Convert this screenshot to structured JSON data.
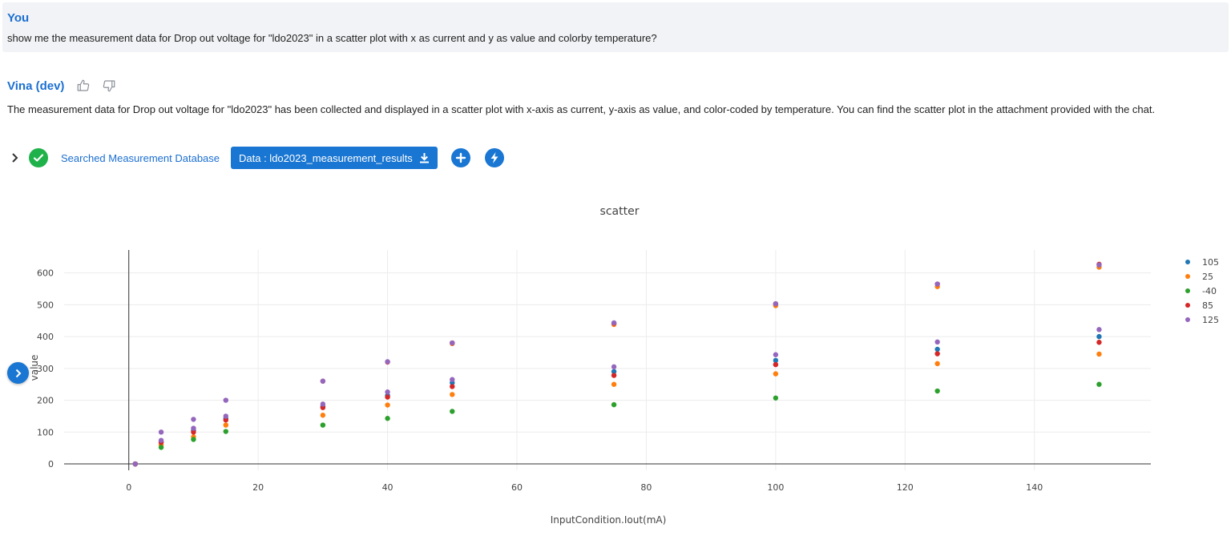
{
  "user": {
    "name": "You",
    "message": "show me the measurement data for Drop out voltage for \"ldo2023\" in a scatter plot with x as current and y as value and colorby temperature?"
  },
  "assistant": {
    "name": "Vina (dev)",
    "message": "The measurement data for Drop out voltage for \"ldo2023\" has been collected and displayed in a scatter plot with x-axis as current, y-axis as value, and color-coded by temperature. You can find the scatter plot in the attachment provided with the chat.",
    "tool_status": "Searched Measurement Database",
    "data_button": "Data : ldo2023_measurement_results"
  },
  "icons": {
    "feedback": [
      "thumbs-up-icon",
      "thumbs-down-icon"
    ],
    "actions": [
      "chevron-right-icon",
      "check-circle-icon",
      "download-icon",
      "plus-icon",
      "bolt-icon"
    ]
  },
  "colors": {
    "accent": "#1976d2",
    "name_blue": "#1b6fd1",
    "success": "#20b24a",
    "user_bg": "#f1f3f6"
  },
  "chart_data": {
    "type": "scatter",
    "title": "scatter",
    "xlabel": "InputCondition.Iout(mA)",
    "ylabel": "value",
    "xlim": [
      -10,
      158
    ],
    "ylim": [
      -20,
      672
    ],
    "xticks": [
      0,
      20,
      40,
      60,
      80,
      100,
      120,
      140
    ],
    "yticks": [
      0,
      100,
      200,
      300,
      400,
      500,
      600
    ],
    "grid": true,
    "legend_position": "top-right",
    "series": [
      {
        "name": "105",
        "color": "#1f77b4",
        "points": [
          [
            1,
            0
          ],
          [
            5,
            68
          ],
          [
            10,
            105
          ],
          [
            15,
            143
          ],
          [
            30,
            180
          ],
          [
            40,
            215
          ],
          [
            50,
            255
          ],
          [
            75,
            290
          ],
          [
            100,
            325
          ],
          [
            125,
            360
          ],
          [
            150,
            400
          ]
        ]
      },
      {
        "name": "25",
        "color": "#ff7f0e",
        "points": [
          [
            1,
            0
          ],
          [
            5,
            60
          ],
          [
            10,
            85
          ],
          [
            15,
            122
          ],
          [
            30,
            153
          ],
          [
            40,
            185
          ],
          [
            50,
            218
          ],
          [
            75,
            250
          ],
          [
            100,
            283
          ],
          [
            125,
            315
          ],
          [
            150,
            345
          ],
          [
            50,
            378
          ],
          [
            75,
            438
          ],
          [
            100,
            497
          ],
          [
            125,
            557
          ],
          [
            150,
            618
          ]
        ]
      },
      {
        "name": "-40",
        "color": "#2ca02c",
        "points": [
          [
            1,
            0
          ],
          [
            5,
            52
          ],
          [
            10,
            77
          ],
          [
            15,
            102
          ],
          [
            30,
            122
          ],
          [
            40,
            143
          ],
          [
            50,
            165
          ],
          [
            75,
            186
          ],
          [
            100,
            207
          ],
          [
            125,
            229
          ],
          [
            150,
            250
          ]
        ]
      },
      {
        "name": "85",
        "color": "#d62728",
        "points": [
          [
            1,
            0
          ],
          [
            5,
            68
          ],
          [
            10,
            100
          ],
          [
            15,
            138
          ],
          [
            30,
            177
          ],
          [
            40,
            210
          ],
          [
            50,
            243
          ],
          [
            75,
            278
          ],
          [
            100,
            312
          ],
          [
            125,
            346
          ],
          [
            150,
            382
          ],
          [
            30,
            260
          ],
          [
            40,
            320
          ],
          [
            50,
            380
          ],
          [
            75,
            442
          ],
          [
            100,
            503
          ],
          [
            125,
            565
          ],
          [
            150,
            627
          ]
        ]
      },
      {
        "name": "125",
        "color": "#9467bd",
        "points": [
          [
            1,
            0
          ],
          [
            5,
            100
          ],
          [
            10,
            140
          ],
          [
            15,
            200
          ],
          [
            30,
            260
          ],
          [
            40,
            321
          ],
          [
            50,
            380
          ],
          [
            75,
            443
          ],
          [
            100,
            503
          ],
          [
            125,
            565
          ],
          [
            150,
            625
          ],
          [
            5,
            74
          ],
          [
            10,
            112
          ],
          [
            15,
            150
          ],
          [
            30,
            188
          ],
          [
            40,
            226
          ],
          [
            50,
            265
          ],
          [
            75,
            305
          ],
          [
            100,
            343
          ],
          [
            125,
            383
          ],
          [
            150,
            422
          ]
        ]
      }
    ]
  }
}
